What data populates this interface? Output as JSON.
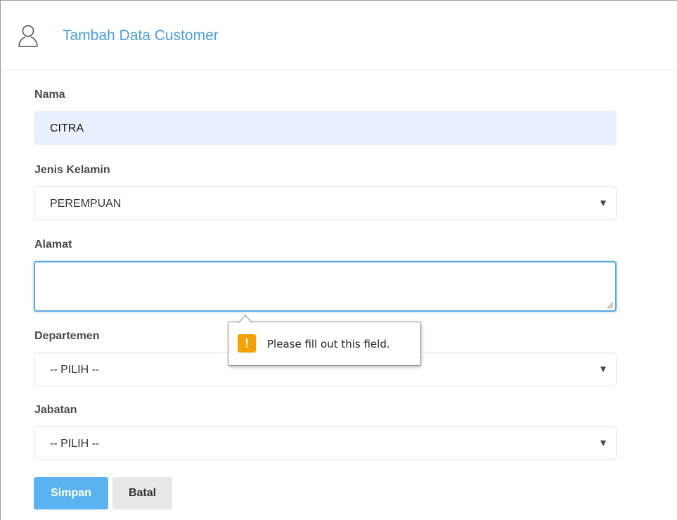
{
  "header": {
    "icon": "user-icon",
    "title": "Tambah Data Customer",
    "title_color": "#4a9fe0"
  },
  "form": {
    "nama": {
      "label": "Nama",
      "value": "CITRA"
    },
    "jenis_kelamin": {
      "label": "Jenis Kelamin",
      "selected": "PEREMPUAN"
    },
    "alamat": {
      "label": "Alamat",
      "value": ""
    },
    "departemen": {
      "label": "Departemen",
      "selected": "-- PILIH --"
    },
    "jabatan": {
      "label": "Jabatan",
      "selected": "-- PILIH --"
    }
  },
  "validation_tooltip": {
    "icon": "warning-icon",
    "icon_glyph": "!",
    "message": "Please fill out this field."
  },
  "buttons": {
    "save_label": "Simpan",
    "cancel_label": "Batal",
    "primary_color": "#5ab3f0"
  }
}
